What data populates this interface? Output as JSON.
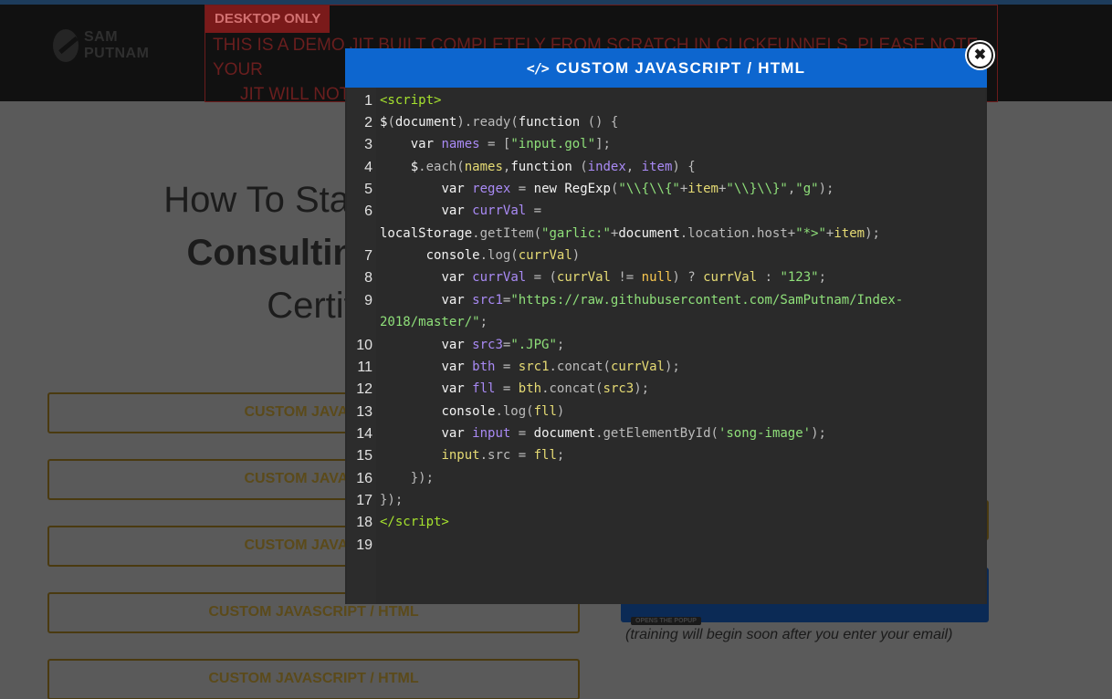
{
  "header": {
    "logo_line1": "SAM",
    "logo_line2": "PUTNAM",
    "demo_badge": "DESKTOP ONLY",
    "demo_line1": "THIS IS A DEMO JIT BUILT COMPLETELY FROM SCRATCH IN CLICKFUNNELS. PLEASE NOTE YOUR",
    "demo_line2": "JIT WILL NOT"
  },
  "page": {
    "headline_line1": "How To Start & Gr",
    "headline_line2": "Consulting Fir",
    "headline_line3": "Certif",
    "buttons": [
      "CUSTOM JAVASCRI",
      "CUSTOM JAVASCRI",
      "CUSTOM JAVASCRI",
      "CUSTOM JAVASCRIPT / HTML",
      "CUSTOM JAVASCRIPT / HTML"
    ],
    "popup_tag": "OPENS THE POPUP",
    "note": "(training will begin soon after you enter your email)"
  },
  "modal": {
    "icon": "code-icon",
    "title": "CUSTOM JAVASCRIPT / HTML",
    "close_icon": "close-icon",
    "line_numbers": [
      "1",
      "2",
      "3",
      "4",
      "5",
      "6",
      "7",
      "8",
      "9",
      "10",
      "11",
      "12",
      "13",
      "14",
      "15",
      "16",
      "17",
      "18",
      "19"
    ]
  },
  "colors": {
    "modal_header": "#0d66cf",
    "editor_bg": "#2a2a2a"
  }
}
